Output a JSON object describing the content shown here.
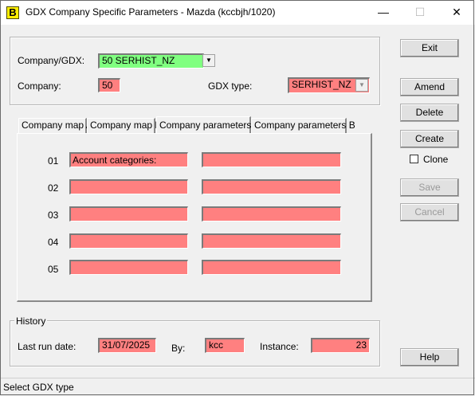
{
  "window": {
    "app_icon_letter": "B",
    "title": "GDX Company Specific Parameters - Mazda (kccbjh/1020)",
    "minimize_glyph": "—",
    "maximize_glyph": "☐",
    "close_glyph": "✕"
  },
  "top": {
    "company_gdx_label": "Company/GDX:",
    "company_gdx_value": "50 SERHIST_NZ",
    "company_label": "Company:",
    "company_value": "50",
    "gdx_type_label": "GDX type:",
    "gdx_type_value": "SERHIST_NZ"
  },
  "tabs": [
    {
      "label": "Company map A"
    },
    {
      "label": "Company map B"
    },
    {
      "label": "Company parameters A"
    },
    {
      "label": "Company parameters B"
    }
  ],
  "active_tab": "Company parameters A",
  "params": {
    "rows": [
      {
        "num": "01",
        "a": "Account categories:",
        "b": ""
      },
      {
        "num": "02",
        "a": "",
        "b": ""
      },
      {
        "num": "03",
        "a": "",
        "b": ""
      },
      {
        "num": "04",
        "a": "",
        "b": ""
      },
      {
        "num": "05",
        "a": "",
        "b": ""
      }
    ]
  },
  "history": {
    "group_label": "History",
    "last_run_label": "Last run date:",
    "last_run_value": "31/07/2025",
    "by_label": "By:",
    "by_value": "kcc",
    "instance_label": "Instance:",
    "instance_value": "23"
  },
  "buttons": {
    "exit": "Exit",
    "amend": "Amend",
    "delete": "Delete",
    "create": "Create",
    "clone_label": "Clone",
    "clone_checked": false,
    "save": "Save",
    "cancel": "Cancel",
    "help": "Help"
  },
  "status": {
    "text": "Select GDX type"
  },
  "colors": {
    "field_red": "#ff8080",
    "field_green": "#80ff80",
    "window_bg": "#f0f0f0"
  }
}
